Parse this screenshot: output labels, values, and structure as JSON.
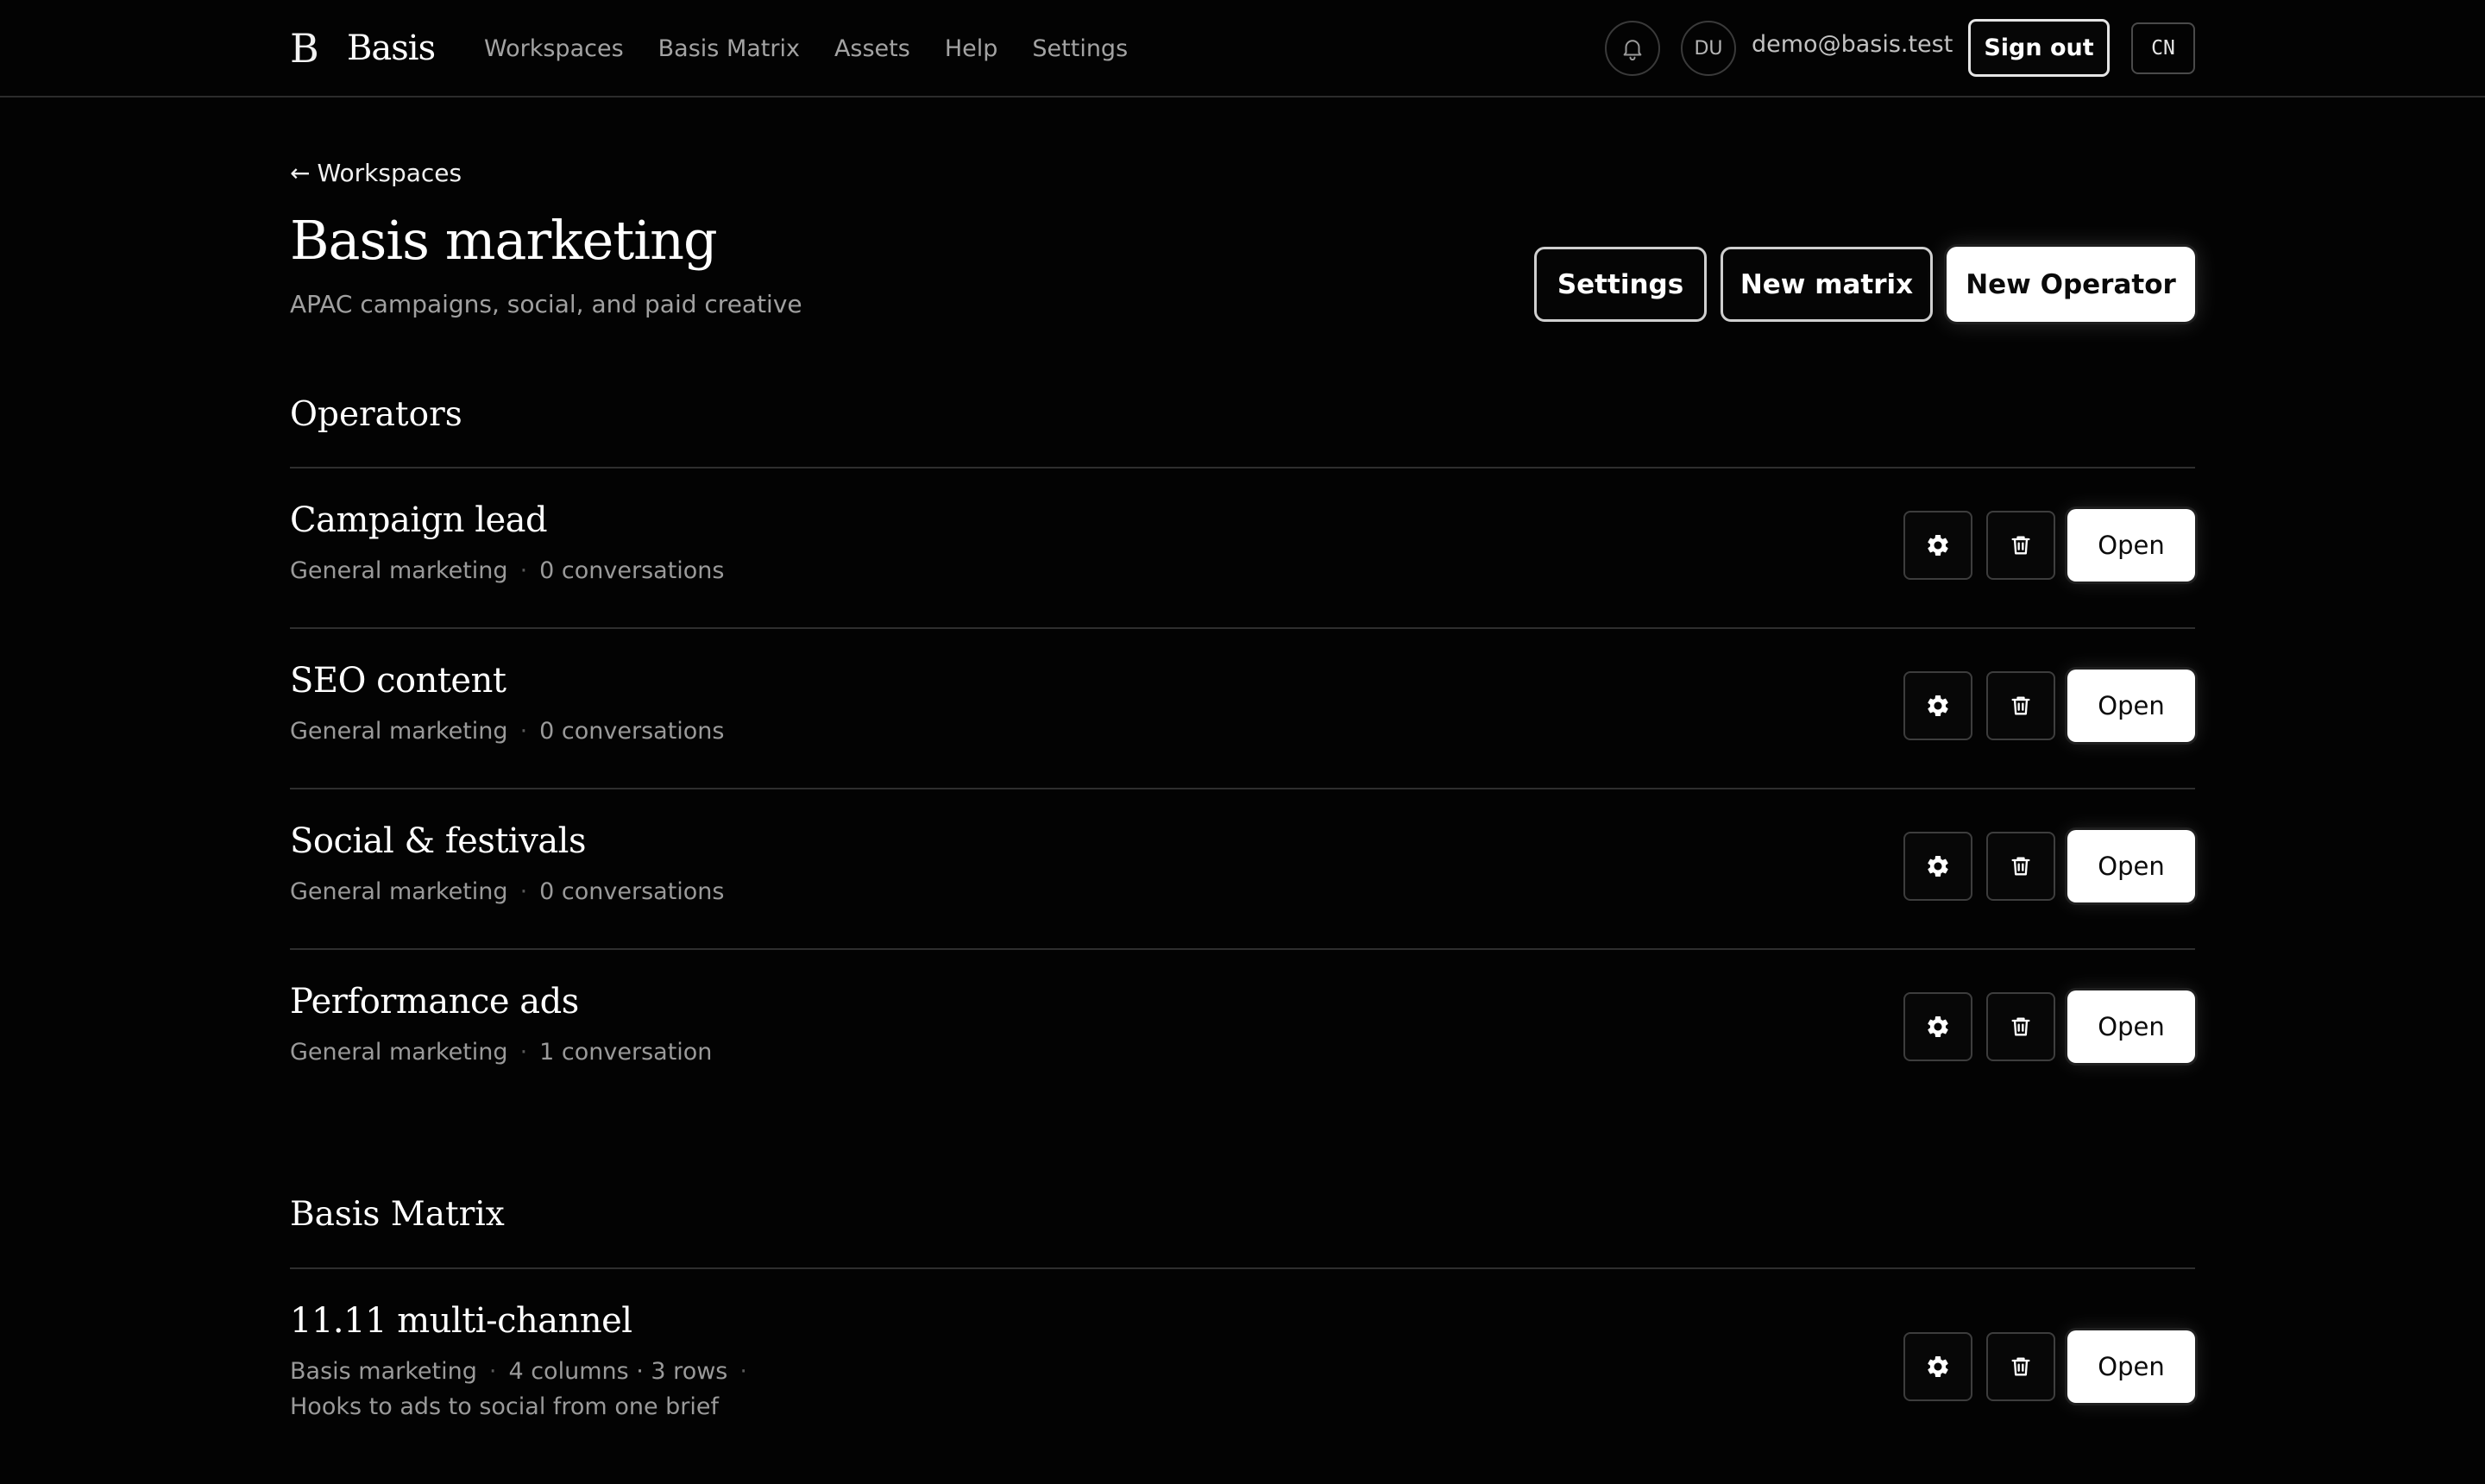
{
  "brand": {
    "mark": "B",
    "name": "Basis"
  },
  "nav": [
    "Workspaces",
    "Basis Matrix",
    "Assets",
    "Help",
    "Settings"
  ],
  "user": {
    "initials": "DU",
    "email": "demo@basis.test",
    "sign_out": "Sign out",
    "lang": "CN"
  },
  "header": {
    "back_arrow": "←",
    "back_label": "Workspaces",
    "title": "Basis marketing",
    "subtitle": "APAC campaigns, social, and paid creative",
    "settings": "Settings",
    "new_matrix": "New matrix",
    "new_operator": "New Operator"
  },
  "operators": {
    "title": "Operators",
    "items": [
      {
        "name": "Campaign lead",
        "category": "General marketing",
        "count": "0 conversations",
        "open": "Open"
      },
      {
        "name": "SEO content",
        "category": "General marketing",
        "count": "0 conversations",
        "open": "Open"
      },
      {
        "name": "Social & festivals",
        "category": "General marketing",
        "count": "0 conversations",
        "open": "Open"
      },
      {
        "name": "Performance ads",
        "category": "General marketing",
        "count": "1 conversation",
        "open": "Open"
      }
    ]
  },
  "matrix": {
    "title": "Basis Matrix",
    "items": [
      {
        "name": "11.11 multi-channel",
        "workspace": "Basis marketing",
        "size": "4 columns · 3 rows",
        "description": "Hooks to ads to social from one brief",
        "open": "Open"
      }
    ]
  },
  "separator": "·"
}
